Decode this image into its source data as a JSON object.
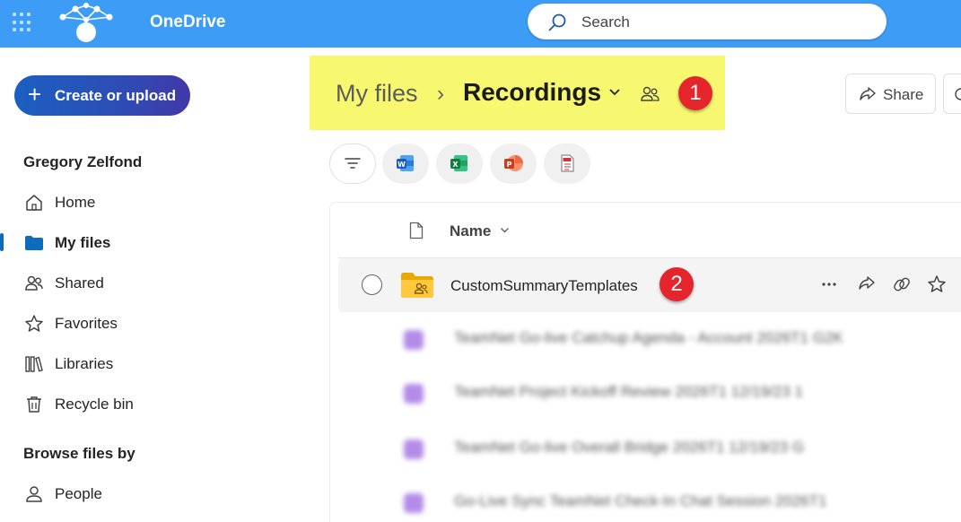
{
  "app": {
    "name": "OneDrive"
  },
  "search": {
    "placeholder": "Search"
  },
  "sidebar": {
    "create_label": "Create or upload",
    "user_name": "Gregory Zelfond",
    "items": [
      {
        "label": "Home",
        "icon": "home-icon"
      },
      {
        "label": "My files",
        "icon": "folder-icon",
        "active": true
      },
      {
        "label": "Shared",
        "icon": "people-icon"
      },
      {
        "label": "Favorites",
        "icon": "star-icon"
      },
      {
        "label": "Libraries",
        "icon": "libraries-icon"
      },
      {
        "label": "Recycle bin",
        "icon": "trash-icon"
      }
    ],
    "browse_title": "Browse files by",
    "browse_items": [
      {
        "label": "People",
        "icon": "person-icon"
      }
    ]
  },
  "breadcrumb": {
    "root": "My files",
    "separator": "›",
    "current": "Recordings",
    "annotation": "1"
  },
  "toolbar": {
    "share_label": "Share"
  },
  "filters": [
    {
      "name": "filter-icon"
    },
    {
      "name": "word-icon"
    },
    {
      "name": "excel-icon"
    },
    {
      "name": "powerpoint-icon"
    },
    {
      "name": "pdf-icon"
    }
  ],
  "list": {
    "column_name": "Name",
    "rows": [
      {
        "name": "CustomSummaryTemplates",
        "type": "shared-folder",
        "annotation": "2"
      }
    ],
    "blurred_rows": [
      "TeamNet Go-live Catchup Agenda - Account 2026T1 G2K",
      "TeamNet Project Kickoff Review 2026T1 12/19/23 1",
      "TeamNet Go-live Overall Bridge 2026T1 12/19/23 G",
      "Go-Live Sync TeamNet Check-In Chat Session 2026T1"
    ]
  },
  "colors": {
    "topbar": "#3d9df6",
    "highlight": "#f7f870",
    "badge": "#e4252b",
    "accent": "#0f6cbd"
  }
}
